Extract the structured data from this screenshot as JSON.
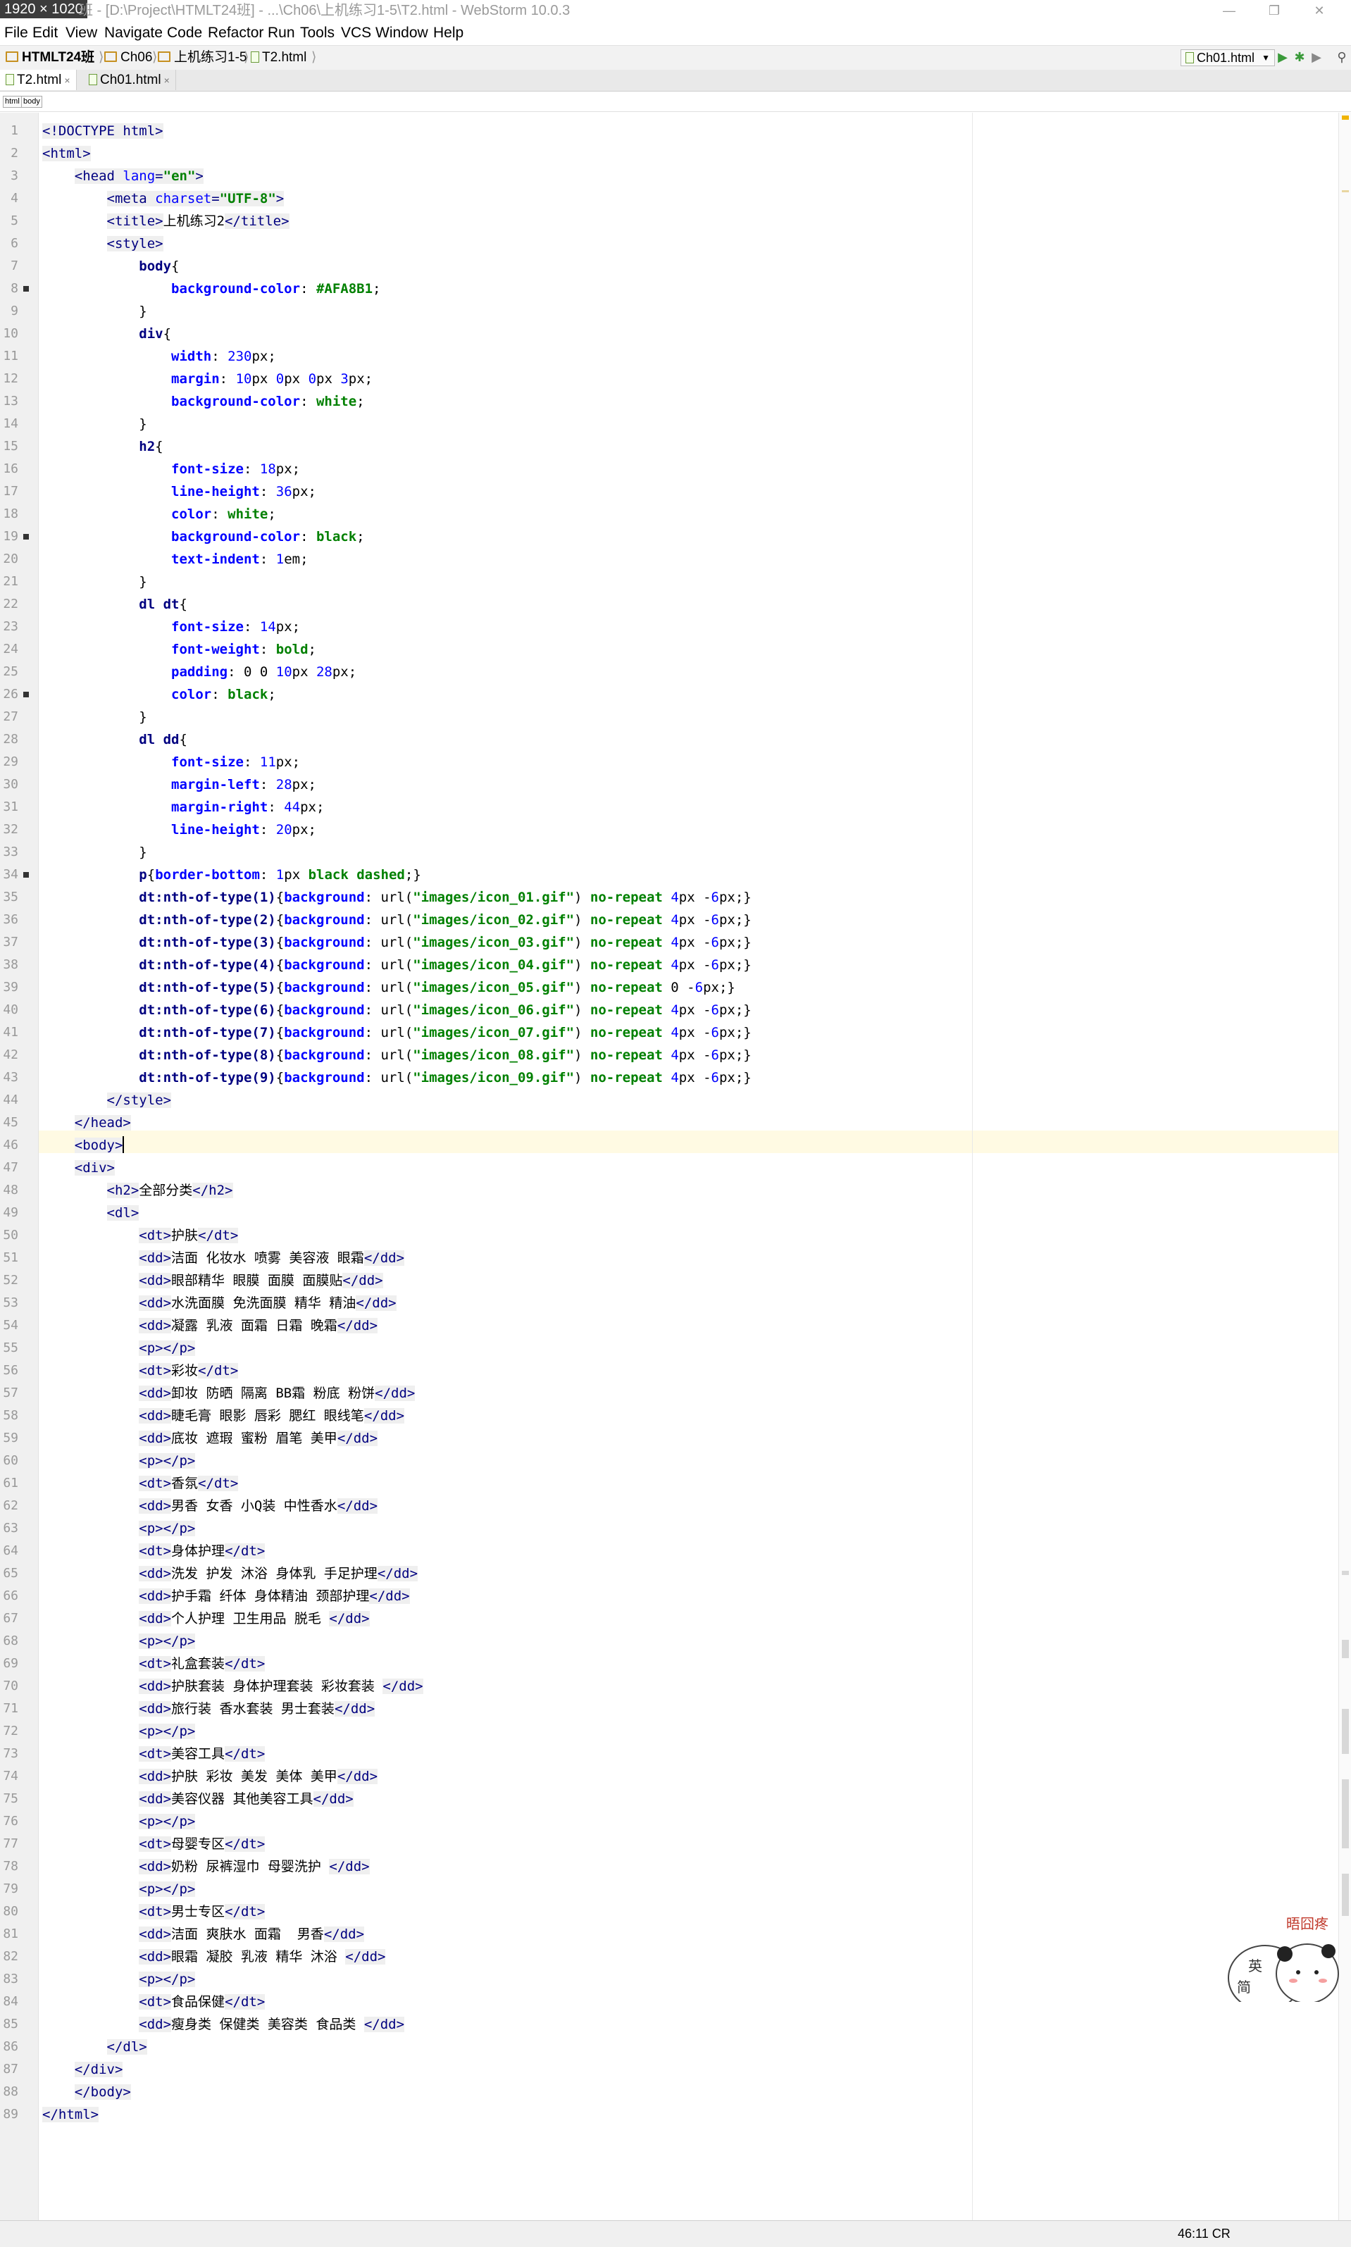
{
  "window": {
    "size_badge": "1920 × 1020",
    "title": "班 - [D:\\Project\\HTMLT24班] - ...\\Ch06\\上机练习1-5\\T2.html - WebStorm 10.0.3",
    "minimize": "—",
    "maximize": "❐",
    "close": "✕"
  },
  "menu": [
    "File",
    "Edit",
    "View",
    "Navigate",
    "Code",
    "Refactor",
    "Run",
    "Tools",
    "VCS",
    "Window",
    "Help"
  ],
  "breadcrumb": {
    "project": "HTMLT24班",
    "folder1": "Ch06",
    "folder2": "上机练习1-5",
    "file": "T2.html"
  },
  "run_config": "Ch01.html",
  "tabs": [
    {
      "label": "T2.html",
      "close": "×"
    },
    {
      "label": "Ch01.html",
      "close": "×"
    }
  ],
  "structure": {
    "html": "html",
    "body": "body"
  },
  "status": {
    "position": "46:11",
    "extra": "CR"
  },
  "sticker": {
    "text1": "晤囧疼",
    "text2": "英",
    "text3": "简"
  },
  "code_lines": [
    "<!DOCTYPE html>",
    "<html>",
    "    <head lang=\"en\">",
    "        <meta charset=\"UTF-8\">",
    "        <title>上机练习2</title>",
    "        <style>",
    "            body{",
    "                background-color: #AFA8B1;",
    "            }",
    "            div{",
    "                width: 230px;",
    "                margin: 10px 0px 0px 3px;",
    "                background-color: white;",
    "            }",
    "            h2{",
    "                font-size: 18px;",
    "                line-height: 36px;",
    "                color: white;",
    "                background-color: black;",
    "                text-indent: 1em;",
    "            }",
    "            dl dt{",
    "                font-size: 14px;",
    "                font-weight: bold;",
    "                padding: 0 0 10px 28px;",
    "                color: black;",
    "            }",
    "            dl dd{",
    "                font-size: 11px;",
    "                margin-left: 28px;",
    "                margin-right: 44px;",
    "                line-height: 20px;",
    "            }",
    "            p{border-bottom: 1px black dashed;}",
    "            dt:nth-of-type(1){background: url(\"images/icon_01.gif\") no-repeat 4px -6px;}",
    "            dt:nth-of-type(2){background: url(\"images/icon_02.gif\") no-repeat 4px -6px;}",
    "            dt:nth-of-type(3){background: url(\"images/icon_03.gif\") no-repeat 4px -6px;}",
    "            dt:nth-of-type(4){background: url(\"images/icon_04.gif\") no-repeat 4px -6px;}",
    "            dt:nth-of-type(5){background: url(\"images/icon_05.gif\") no-repeat 0 -6px;}",
    "            dt:nth-of-type(6){background: url(\"images/icon_06.gif\") no-repeat 4px -6px;}",
    "            dt:nth-of-type(7){background: url(\"images/icon_07.gif\") no-repeat 4px -6px;}",
    "            dt:nth-of-type(8){background: url(\"images/icon_08.gif\") no-repeat 4px -6px;}",
    "            dt:nth-of-type(9){background: url(\"images/icon_09.gif\") no-repeat 4px -6px;}",
    "        </style>",
    "    </head>",
    "    <body>",
    "    <div>",
    "        <h2>全部分类</h2>",
    "        <dl>",
    "            <dt>护肤</dt>",
    "            <dd>洁面 化妆水 喷雾 美容液 眼霜</dd>",
    "            <dd>眼部精华 眼膜 面膜 面膜贴</dd>",
    "            <dd>水洗面膜 免洗面膜 精华 精油</dd>",
    "            <dd>凝露 乳液 面霜 日霜 晚霜</dd>",
    "            <p></p>",
    "            <dt>彩妆</dt>",
    "            <dd>卸妆 防晒 隔离 BB霜 粉底 粉饼</dd>",
    "            <dd>睫毛膏 眼影 唇彩 腮红 眼线笔</dd>",
    "            <dd>底妆 遮瑕 蜜粉 眉笔 美甲</dd>",
    "            <p></p>",
    "            <dt>香氛</dt>",
    "            <dd>男香 女香 小Q装 中性香水</dd>",
    "            <p></p>",
    "            <dt>身体护理</dt>",
    "            <dd>洗发 护发 沐浴 身体乳 手足护理</dd>",
    "            <dd>护手霜 纤体 身体精油 颈部护理</dd>",
    "            <dd>个人护理 卫生用品 脱毛 </dd>",
    "            <p></p>",
    "            <dt>礼盒套装</dt>",
    "            <dd>护肤套装 身体护理套装 彩妆套装 </dd>",
    "            <dd>旅行装 香水套装 男士套装</dd>",
    "            <p></p>",
    "            <dt>美容工具</dt>",
    "            <dd>护肤 彩妆 美发 美体 美甲</dd>",
    "            <dd>美容仪器 其他美容工具</dd>",
    "            <p></p>",
    "            <dt>母婴专区</dt>",
    "            <dd>奶粉 尿裤湿巾 母婴洗护 </dd>",
    "            <p></p>",
    "            <dt>男士专区</dt>",
    "            <dd>洁面 爽肤水 面霜  男香</dd>",
    "            <dd>眼霜 凝胶 乳液 精华 沐浴 </dd>",
    "            <p></p>",
    "            <dt>食品保健</dt>",
    "            <dd>瘦身类 保健类 美容类 食品类 </dd>",
    "        </dl>",
    "    </div>",
    "    </body>",
    "</html>"
  ]
}
